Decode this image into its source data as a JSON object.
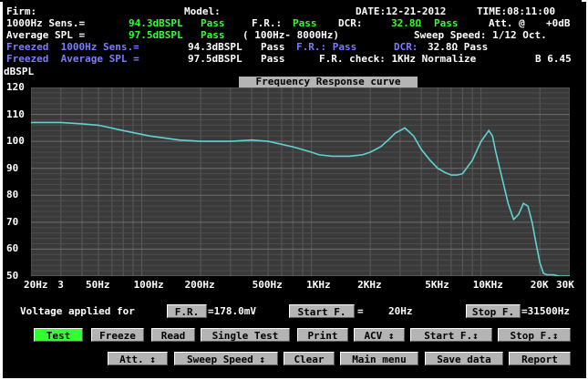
{
  "header": {
    "firm_label": "Firm:",
    "model_label": "Model:",
    "date": "DATE:12-21-2012",
    "time": "TIME:08:11:00",
    "row2": {
      "sens_label": "1000Hz Sens.=",
      "sens_value": "94.3dBSPL",
      "sens_status": "Pass",
      "fr_label": "F.R.:",
      "fr_status": "Pass",
      "dcr_label": "DCR:",
      "dcr_value": "32.8Ω",
      "dcr_status": "Pass",
      "att_label": "Att. @",
      "att_value": "+0dB"
    },
    "row3": {
      "spl_label": "Average SPL =",
      "spl_value": "97.5dBSPL",
      "spl_status": "Pass",
      "range": "( 100Hz- 8000Hz)",
      "sweep": "Sweep Speed: 1/12 Oct."
    },
    "row4": {
      "label": "Freezed  1000Hz Sens.=",
      "value": "94.3dBSPL",
      "status": "Pass",
      "fr": "F.R.: Pass",
      "dcr": "DCR:",
      "dcr_value": "32.8Ω Pass"
    },
    "row5": {
      "label": "Freezed  Average SPL =",
      "value": "97.5dBSPL",
      "status": "Pass",
      "frcheck": "F.R. check: 1KHz Normalize",
      "ver": "B 6.45"
    }
  },
  "chart": {
    "title": "Frequency Response curve",
    "yunit": "dBSPL"
  },
  "chart_data": {
    "type": "line",
    "title": "Frequency Response curve",
    "xlabel": "",
    "ylabel": "dBSPL",
    "ylim": [
      50,
      120
    ],
    "xscale": "log",
    "xlim": [
      20,
      30000
    ],
    "yticks": [
      120,
      110,
      100,
      90,
      80,
      70,
      60,
      50
    ],
    "xtick_labels": [
      "20Hz",
      "3",
      "50Hz",
      "100Hz",
      "200Hz",
      "500Hz",
      "1KHz",
      "2KHz",
      "5KHz",
      "10KHz",
      "20K",
      "30K"
    ],
    "xtick_values": [
      20,
      30,
      50,
      100,
      200,
      500,
      1000,
      2000,
      5000,
      10000,
      20000,
      30000
    ],
    "grid": true,
    "series": [
      {
        "x": [
          20,
          30,
          40,
          50,
          70,
          100,
          150,
          200,
          300,
          400,
          500,
          700,
          900,
          1000,
          1200,
          1500,
          1800,
          2000,
          2300,
          2600,
          2800,
          3200,
          3600,
          4000,
          4500,
          5000,
          5500,
          6000,
          6500,
          7000,
          8000,
          9000,
          10000,
          10500,
          11000,
          12000,
          13000,
          14000,
          15000,
          16000,
          17000,
          18000,
          19000,
          20000,
          21000,
          22000,
          24000,
          26000,
          28000,
          30000
        ],
        "y": [
          107,
          107,
          106.5,
          106,
          104,
          102,
          100.5,
          100,
          100,
          100.5,
          100,
          98,
          96,
          95,
          94.5,
          94.5,
          95,
          96,
          98,
          101,
          103,
          105,
          102,
          97,
          93,
          90,
          88.5,
          87.5,
          87.5,
          88,
          93,
          100,
          104,
          102,
          96,
          86,
          77,
          71,
          73,
          77,
          76,
          70,
          62,
          55,
          51,
          50.5,
          50.5,
          50,
          50,
          50
        ]
      }
    ]
  },
  "controls": {
    "voltage_label": "Voltage applied for",
    "fr_btn": "F.R.",
    "voltage_value": "=178.0mV",
    "start_btn": "Start F.",
    "start_eq": "=",
    "start_value": "20Hz",
    "stop_btn": "Stop F.",
    "stop_value": "=31500Hz"
  },
  "buttons_row1": [
    "Test",
    "Freeze",
    "Read",
    "Single Test",
    "Print",
    "ACV ↕",
    "Start F.↕",
    "Stop F.↕"
  ],
  "buttons_row2": [
    "Att. ↕",
    "Sweep Speed ↕",
    "Clear",
    "Main menu",
    "Save data",
    "Report"
  ],
  "colors": {
    "curve": "#5fd3d3",
    "plot_bg": "#3a3a3a",
    "pass": "#33ff33",
    "freezed": "#7b7bff",
    "active_button": "#33ff33"
  }
}
